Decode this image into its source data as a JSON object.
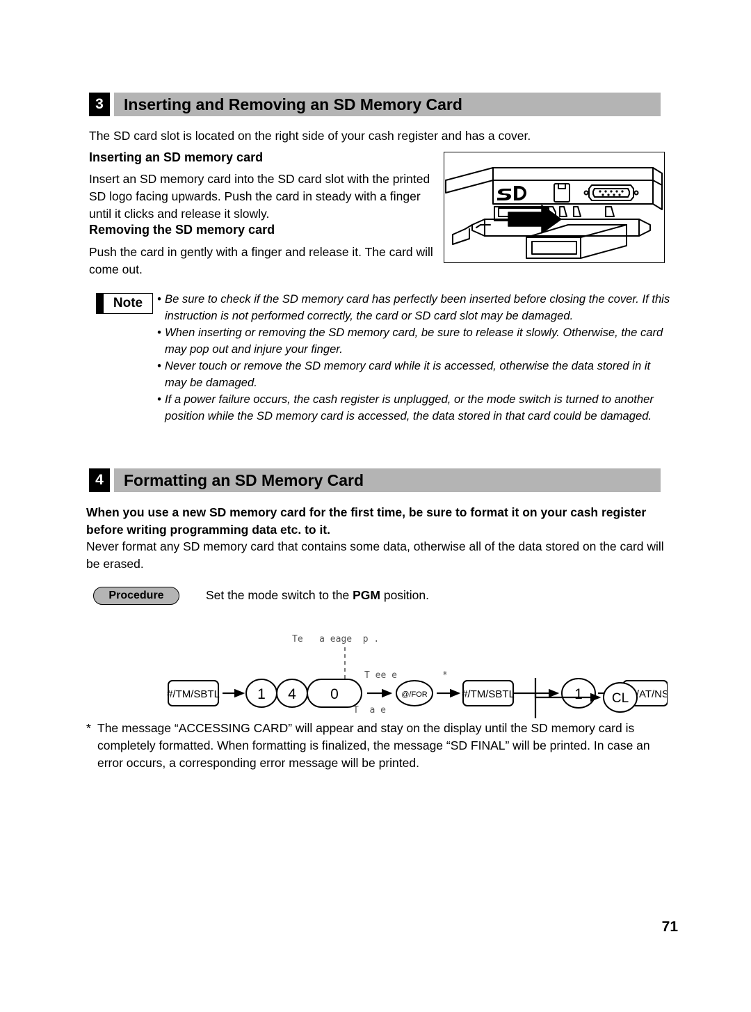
{
  "page": {
    "number": "71"
  },
  "section3": {
    "badge": "3",
    "title": "Inserting and Removing an SD Memory Card",
    "intro": "The SD card slot is located on the right side of your cash register and has a cover.",
    "sub1_title": "Inserting an SD memory card",
    "sub1_text": "Insert an SD memory card into the SD card slot with the printed SD logo facing upwards. Push the card in steady with a finger until it clicks and release it slowly.",
    "sub2_title": "Removing the SD memory card",
    "sub2_text": "Push the card in gently with a finger and release it. The card will come out.",
    "illustration_alt": "sd-card-slot-illustration",
    "illustration_sd_logo": "SD"
  },
  "note": {
    "label": "Note",
    "bullet_mark": "•",
    "items": [
      "Be sure to check if the SD memory card has perfectly been inserted before closing the cover. If this instruction is not performed correctly, the card or SD card slot may be damaged.",
      "When inserting or removing the SD memory card, be sure to release it slowly. Otherwise, the card may pop out and injure your finger.",
      "Never touch or remove the SD memory card while it is accessed, otherwise the data stored in it may be damaged.",
      "If a power failure occurs, the cash register is unplugged, or the mode switch is turned to another position while the SD memory card is accessed, the data stored in that card could be damaged."
    ]
  },
  "section4": {
    "badge": "4",
    "title": "Formatting an SD Memory Card",
    "bold_intro": "When you use a new SD memory card for the first time, be sure to format it on your cash register before writing programming data etc. to it.",
    "text": "Never format any SD memory card that contains some data, otherwise all of the data stored on the card will be erased."
  },
  "procedure": {
    "label": "Procedure",
    "description_pre": "Set the mode switch to the ",
    "description_bold": "PGM",
    "description_post": " position."
  },
  "key_sequence": {
    "keys": {
      "tm_sbtl_1": "#/TM/SBTL",
      "digit_1": "1",
      "digit_4": "4",
      "digit_0": "0",
      "at_for": "@/FOR",
      "tm_sbtl_2": "#/TM/SBTL",
      "digit_1b": "1",
      "ca_at_ns": "CA/AT/NS",
      "cl": "CL"
    },
    "annotations": {
      "top_line": "Te   a eage  p .",
      "mid_line": "T ee e",
      "asterisk": "*",
      "bottom_line": "T  a e"
    }
  },
  "footnote": {
    "marker": "*",
    "text": "The message “ACCESSING CARD” will appear and stay on the display until the SD memory card is completely formatted. When formatting is finalized, the message “SD FINAL” will be printed. In case an error occurs, a corresponding error message will be printed."
  }
}
